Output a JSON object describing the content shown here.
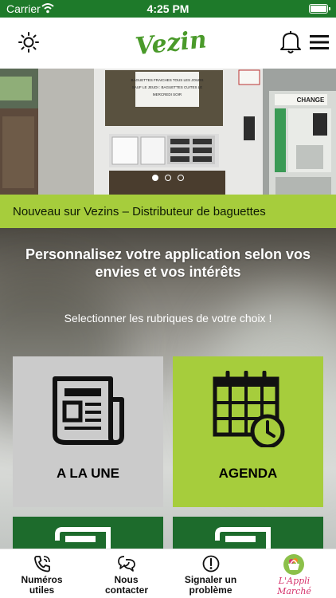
{
  "status_bar": {
    "carrier": "Carrier",
    "time": "4:25 PM"
  },
  "header": {
    "logo_text": "Vezins!"
  },
  "hero": {
    "vending_notice": "BAGUETTES FRAICHES TOUS LES JOURS SAUF LE JEUDI : BAGUETTES CUITES LE MERCREDI SOIR",
    "change_sign": "CHANGE",
    "slide_count": 3,
    "active_slide": 1
  },
  "news_bar": {
    "text": "Nouveau sur Vezins – Distributeur de baguettes"
  },
  "panel": {
    "title": "Personnalisez votre application selon vos envies et vos intérêts",
    "subtitle": "Selectionner les rubriques de votre choix !",
    "tiles": [
      {
        "label": "A LA UNE",
        "icon": "newspaper-icon"
      },
      {
        "label": "AGENDA",
        "icon": "calendar-clock-icon"
      }
    ]
  },
  "bottom_nav": [
    {
      "label": "Numéros utiles",
      "icon": "phone-icon"
    },
    {
      "label": "Nous contacter",
      "icon": "chat-bubbles-icon"
    },
    {
      "label": "Signaler un problème",
      "icon": "exclamation-icon"
    },
    {
      "label": "L'Appli Marché",
      "icon": "market-basket-icon"
    }
  ],
  "colors": {
    "status_green": "#1e7a2a",
    "lime": "#a6cd3c",
    "dark_green": "#1d6b2c",
    "grey_tile": "#cbcbcb"
  }
}
